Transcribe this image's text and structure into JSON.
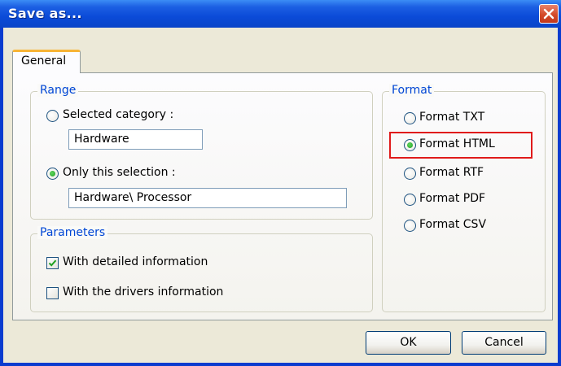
{
  "window": {
    "title": "Save as..."
  },
  "tabs": [
    {
      "label": "General",
      "selected": true
    }
  ],
  "range": {
    "legend": "Range",
    "selected_category": {
      "label": "Selected category :",
      "checked": false,
      "value": "Hardware"
    },
    "only_this_selection": {
      "label": "Only this selection :",
      "checked": true,
      "value": "Hardware\\ Processor"
    }
  },
  "parameters": {
    "legend": "Parameters",
    "detailed_info": {
      "label": "With detailed information",
      "checked": true
    },
    "drivers_info": {
      "label": "With the drivers information",
      "checked": false
    }
  },
  "format": {
    "legend": "Format",
    "options": [
      {
        "label": "Format TXT",
        "checked": false
      },
      {
        "label": "Format HTML",
        "checked": true
      },
      {
        "label": "Format RTF",
        "checked": false
      },
      {
        "label": "Format PDF",
        "checked": false
      },
      {
        "label": "Format CSV",
        "checked": false
      }
    ]
  },
  "buttons": {
    "ok": "OK",
    "cancel": "Cancel"
  },
  "colors": {
    "titlebar": "#0a44c8",
    "legend_text": "#0046d5",
    "highlight": "#e01b1b",
    "tab_accent": "#f7b435",
    "dialog_bg": "#ece9d8"
  }
}
